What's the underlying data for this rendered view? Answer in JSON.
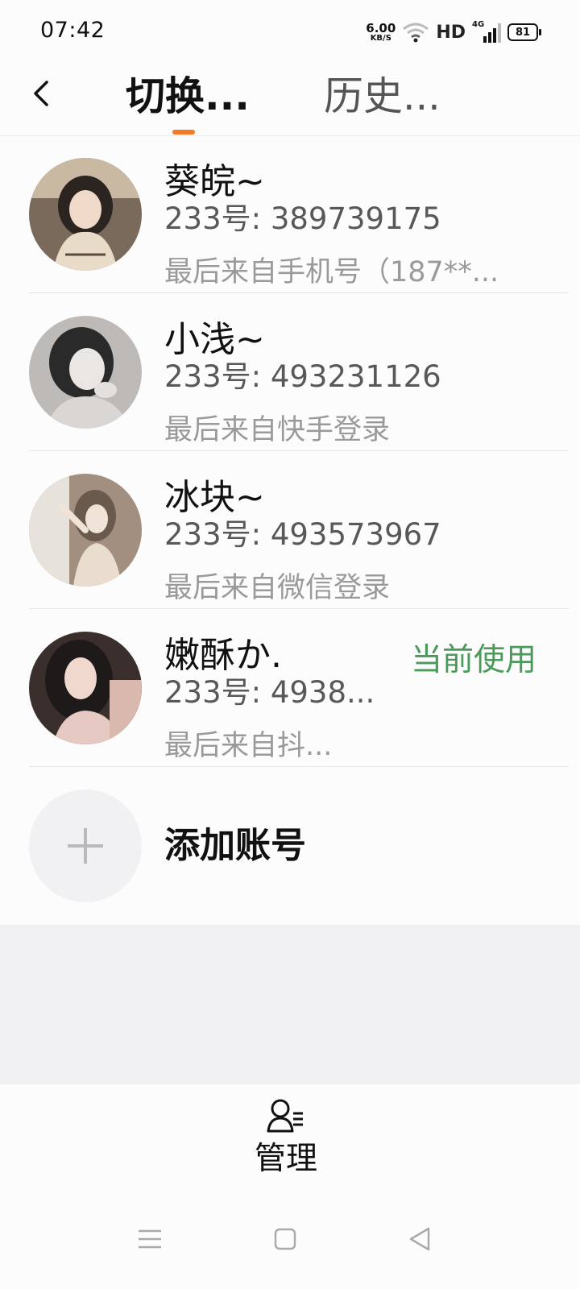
{
  "status_bar": {
    "time": "07:42",
    "net_speed_value": "6.00",
    "net_speed_unit": "KB/S",
    "hd_label": "HD",
    "network_label": "4G",
    "battery_level": "81"
  },
  "header": {
    "tab_switch": "切换...",
    "tab_history": "历史...",
    "accent_color": "#f07b24"
  },
  "accounts": [
    {
      "name": "葵皖~",
      "uid": "233号: 389739175",
      "last_login": "最后来自手机号（187**...",
      "avatar_colors": [
        "#2b2420",
        "#e8dcc8"
      ]
    },
    {
      "name": "小浅~",
      "uid": "233号: 493231126",
      "last_login": "最后来自快手登录",
      "avatar_colors": [
        "#2a2a2a",
        "#d9d6d4"
      ]
    },
    {
      "name": "冰块~",
      "uid": "233号: 493573967",
      "last_login": "最后来自微信登录",
      "avatar_colors": [
        "#6a5a4e",
        "#e9ddd0"
      ]
    },
    {
      "name": "嫩酥か.",
      "uid": "233号: 4938...",
      "last_login": "最后来自抖...",
      "current_label": "当前使用",
      "avatar_colors": [
        "#1e1a1a",
        "#e6c9c2"
      ]
    }
  ],
  "add_account": {
    "label": "添加账号"
  },
  "bottom": {
    "manage_label": "管理"
  },
  "colors": {
    "current_green": "#4c9a5a",
    "secondary_text": "#585858",
    "tertiary_text": "#9a9a9a"
  }
}
